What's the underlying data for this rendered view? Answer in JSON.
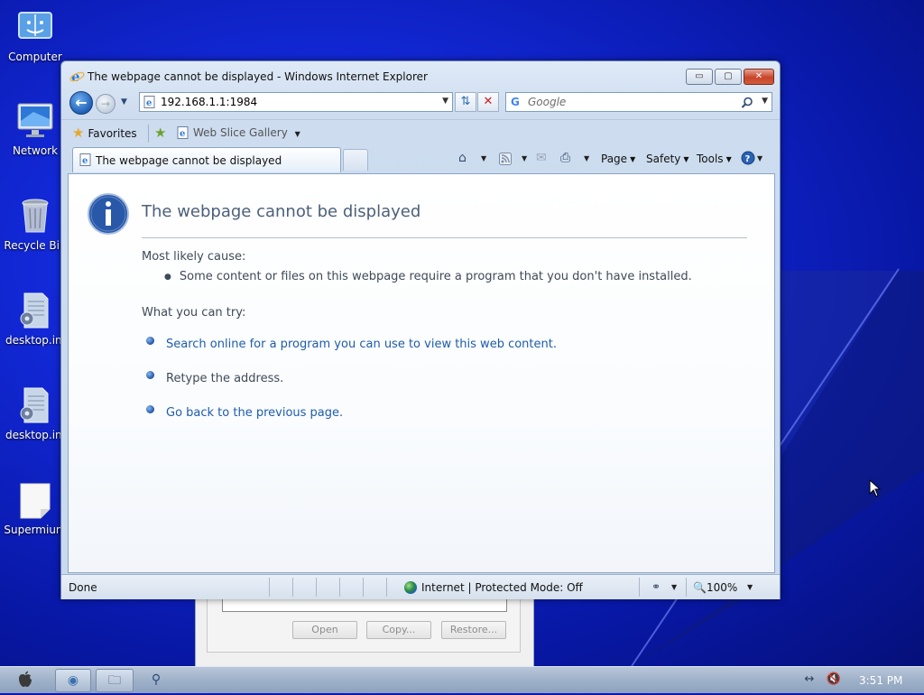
{
  "desktop": {
    "icons": [
      {
        "label": "Computer",
        "icon": "computer-icon"
      },
      {
        "label": "Network",
        "icon": "network-monitor-icon"
      },
      {
        "label": "Recycle Bin",
        "icon": "recycle-bin-icon"
      },
      {
        "label": "desktop.ini",
        "icon": "config-file-icon"
      },
      {
        "label": "desktop.ini",
        "icon": "config-file-icon"
      },
      {
        "label": "Supermium",
        "icon": "blank-file-icon"
      }
    ]
  },
  "background_dialog": {
    "buttons": [
      "Open",
      "Copy...",
      "Restore..."
    ]
  },
  "window": {
    "title": "The webpage cannot be displayed - Windows Internet Explorer",
    "controls": {
      "minimize": "▭",
      "maximize": "▢",
      "close": "✕"
    }
  },
  "navbar": {
    "address": "192.168.1.1:1984",
    "search_placeholder": "Google",
    "search_engine_glyph": "G"
  },
  "favorites_bar": {
    "favorites_label": "Favorites",
    "web_slice_label": "Web Slice Gallery"
  },
  "tabs": [
    {
      "label": "The webpage cannot be displayed",
      "active": true
    }
  ],
  "command_bar": {
    "page": "Page",
    "safety": "Safety",
    "tools": "Tools"
  },
  "error_page": {
    "title": "The webpage cannot be displayed",
    "cause_heading": "Most likely cause:",
    "cause_item": "Some content or files on this webpage require a program that you don't have installed.",
    "try_heading": "What you can try:",
    "try_items": [
      {
        "text": "Search online for a program you can use to view this web content.",
        "link": true
      },
      {
        "text": "Retype the address.",
        "link": false
      },
      {
        "text": "Go back to the previous page.",
        "link": true
      }
    ]
  },
  "statusbar": {
    "status": "Done",
    "zone": "Internet | Protected Mode: Off",
    "zoom": "100%"
  },
  "taskbar": {
    "time": "3:51 PM"
  }
}
